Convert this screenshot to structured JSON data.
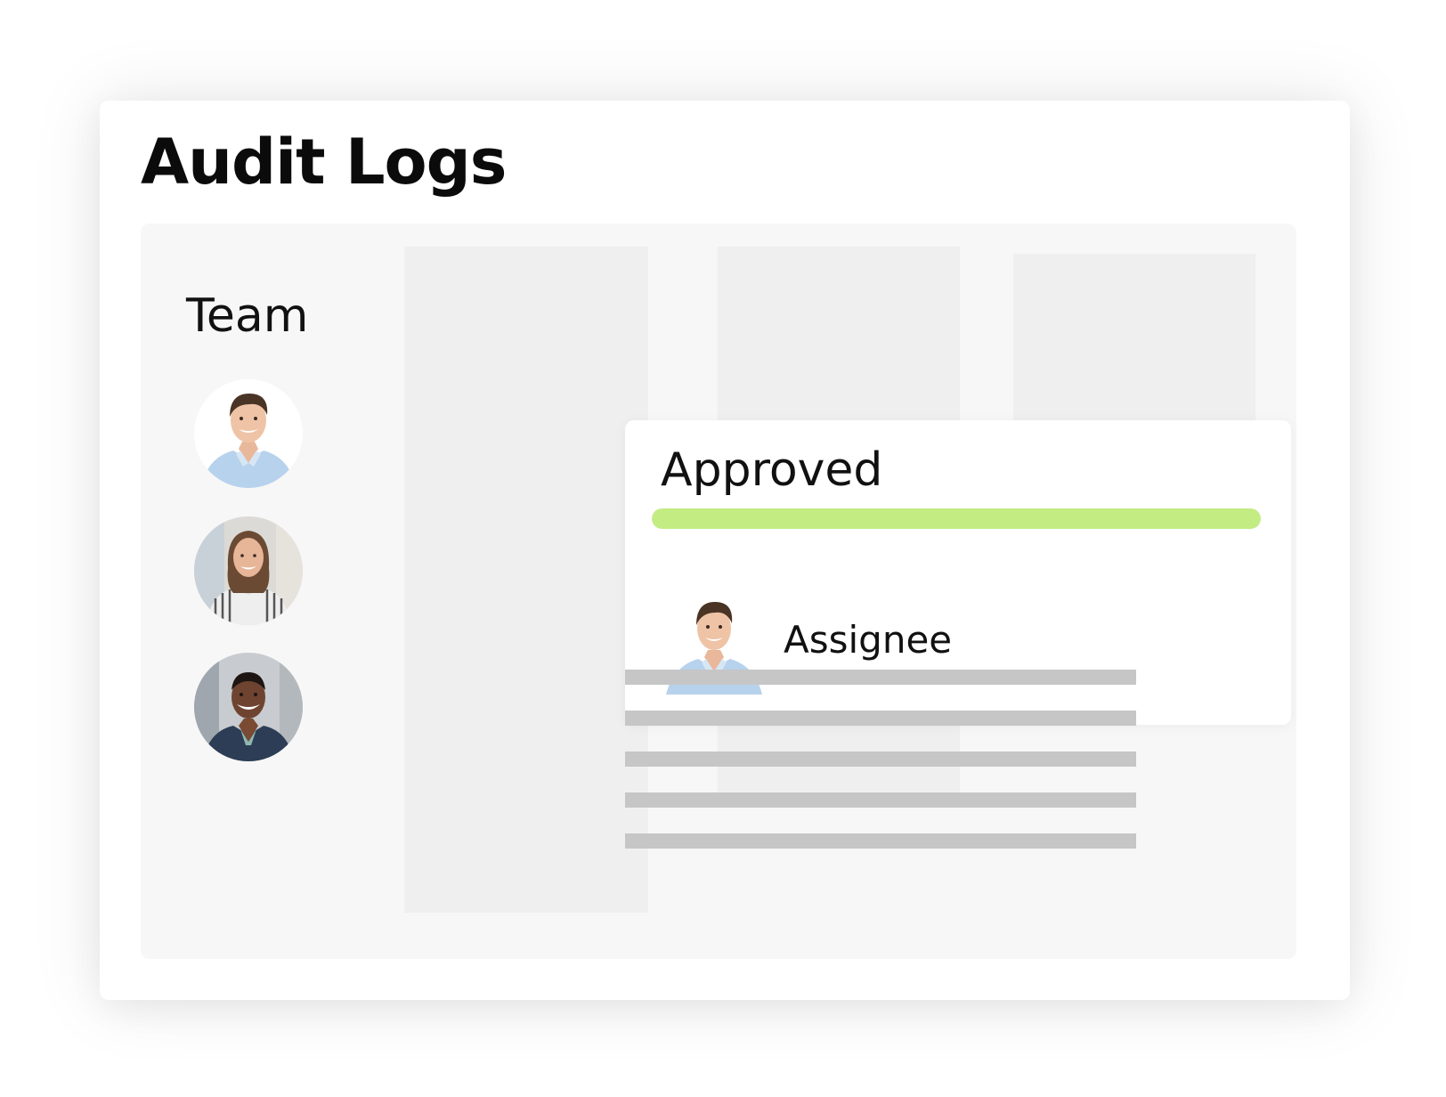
{
  "page": {
    "title": "Audit Logs"
  },
  "team": {
    "label": "Team",
    "members": [
      {
        "name": "team-member-1",
        "icon": "avatar-man-light-shirt"
      },
      {
        "name": "team-member-2",
        "icon": "avatar-woman-striped-shirt"
      },
      {
        "name": "team-member-3",
        "icon": "avatar-man-dark-jacket"
      }
    ]
  },
  "card": {
    "status": "Approved",
    "progress": 1.0,
    "assignee_label": "Assignee",
    "assignee_icon": "avatar-man-light-shirt"
  },
  "colors": {
    "progress": "#c3ec83",
    "placeholder_line": "#c6c6c6",
    "column": "#efefef",
    "board": "#f7f7f7"
  }
}
